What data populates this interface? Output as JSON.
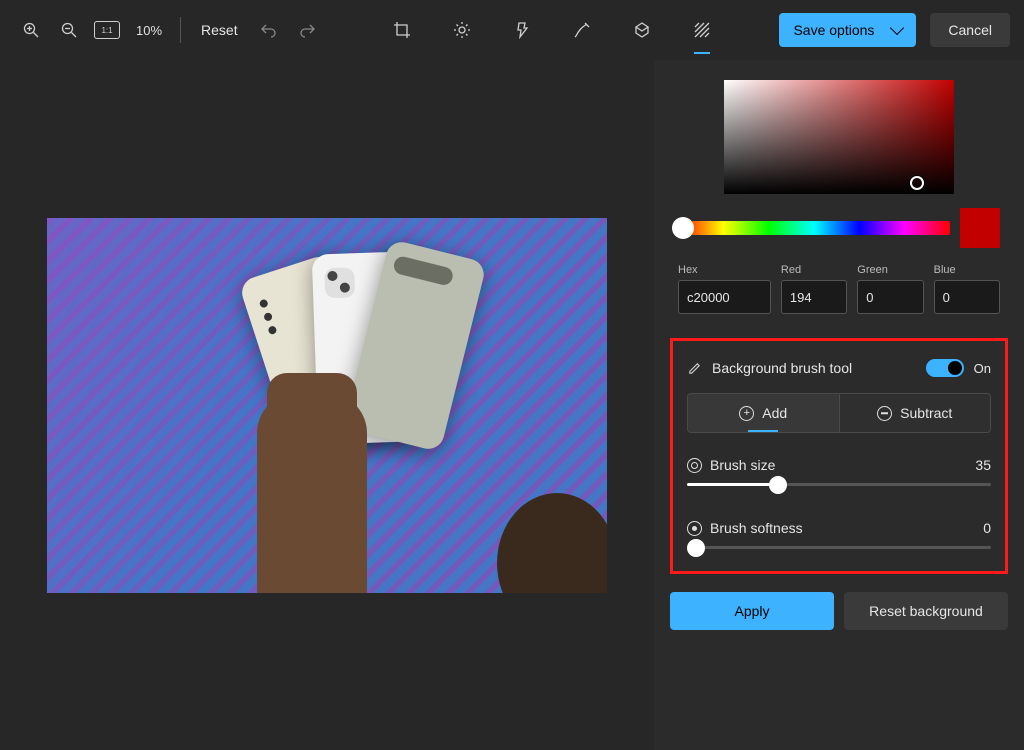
{
  "toolbar": {
    "zoom_percent": "10%",
    "reset_label": "Reset",
    "save_label": "Save options",
    "cancel_label": "Cancel"
  },
  "color": {
    "hex_label": "Hex",
    "red_label": "Red",
    "green_label": "Green",
    "blue_label": "Blue",
    "hex": "c20000",
    "red": "194",
    "green": "0",
    "blue": "0",
    "swatch_hex": "#c20000"
  },
  "brush": {
    "title": "Background brush tool",
    "toggle": "On",
    "add_label": "Add",
    "subtract_label": "Subtract",
    "size_label": "Brush size",
    "size_value": "35",
    "size_percent": 30,
    "softness_label": "Brush softness",
    "softness_value": "0",
    "softness_percent": 0
  },
  "actions": {
    "apply": "Apply",
    "reset_bg": "Reset background"
  }
}
